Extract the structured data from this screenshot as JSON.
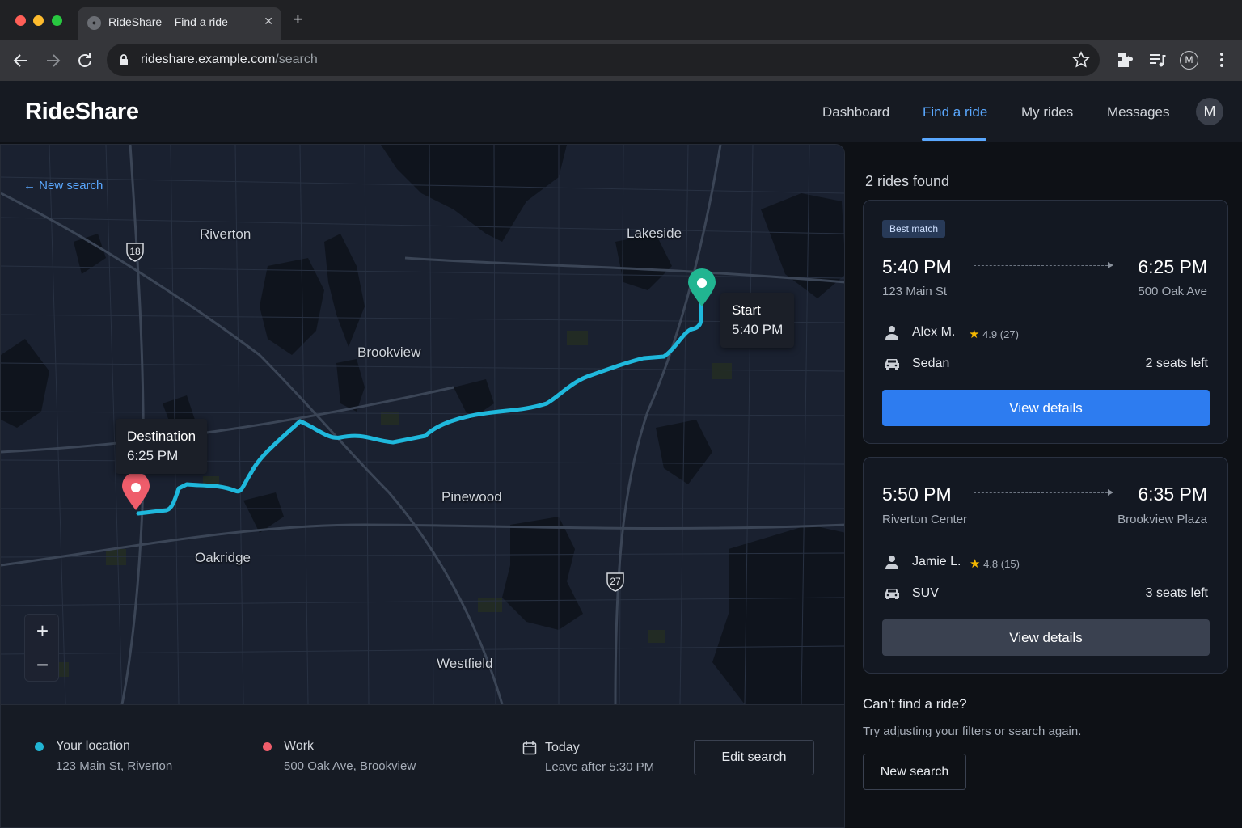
{
  "browser": {
    "tab_title": "RideShare – Find a ride",
    "url_host": "rideshare.example.com",
    "url_path": "/search",
    "profile_initial": "M"
  },
  "app": {
    "brand": "RideShare",
    "nav": [
      {
        "label": "Dashboard",
        "active": false
      },
      {
        "label": "Find a ride",
        "active": true
      },
      {
        "label": "My rides",
        "active": false
      },
      {
        "label": "Messages",
        "active": false
      }
    ],
    "avatar_initial": "M"
  },
  "map": {
    "back_link": "New search",
    "places": [
      "Riverton",
      "Lakeside",
      "Brookview",
      "Pinewood",
      "Oakridge",
      "Westfield"
    ],
    "highways": [
      "18",
      "27"
    ],
    "start_callout": {
      "title": "Start",
      "time": "5:40 PM"
    },
    "destination_callout": {
      "title": "Destination",
      "time": "6:25 PM"
    },
    "zoom_in": "+",
    "zoom_out": "−",
    "colors": {
      "route": "#1fb8dc",
      "start_pin": "#21b591",
      "destination_pin": "#ef5d6b"
    }
  },
  "summary": {
    "origin": {
      "title": "Your location",
      "address": "123 Main St, Riverton",
      "dot_color": "#21b5d4"
    },
    "destination": {
      "title": "Work",
      "address": "500 Oak Ave, Brookview",
      "dot_color": "#ef5d6b"
    },
    "when": {
      "title": "Today",
      "detail": "Leave after 5:30 PM"
    },
    "edit_button": "Edit search"
  },
  "results": {
    "heading": "2 rides found",
    "rides": [
      {
        "badge": "Best match",
        "depart_time": "5:40 PM",
        "depart_place": "123 Main St",
        "arrive_time": "6:25 PM",
        "arrive_place": "500 Oak Ave",
        "driver": "Alex M.",
        "rating": "4.9",
        "reviews": "(27)",
        "vehicle": "Sedan",
        "seats": "2 seats left",
        "button": "View details"
      },
      {
        "depart_time": "5:50 PM",
        "depart_place": "Riverton Center",
        "arrive_time": "6:35 PM",
        "arrive_place": "Brookview Plaza",
        "driver": "Jamie L.",
        "rating": "4.8",
        "reviews": "(15)",
        "vehicle": "SUV",
        "seats": "3 seats left",
        "button": "View details"
      }
    ],
    "empty_title": "Can’t find a ride?",
    "empty_sub": "Try adjusting your filters or search again.",
    "empty_button": "New search"
  }
}
